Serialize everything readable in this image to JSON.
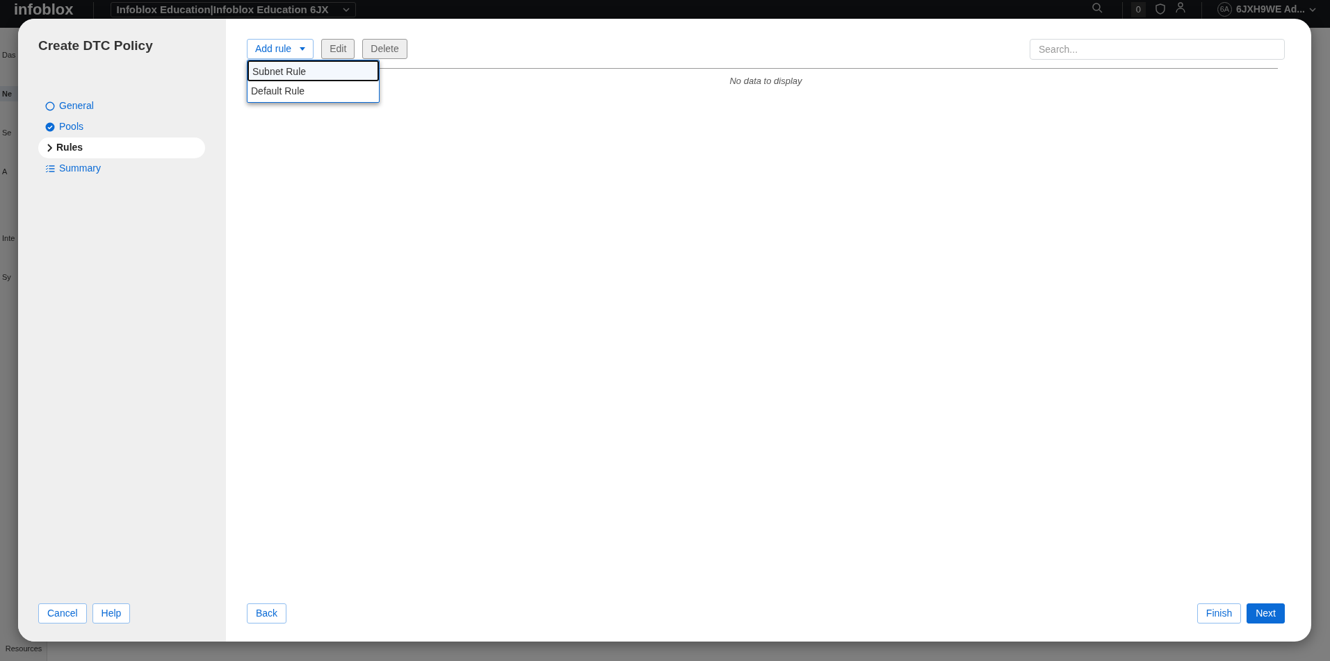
{
  "app": {
    "brand": "infoblox",
    "tenant": "Infoblox Education|Infoblox Education 6JX",
    "notifications": "0",
    "user_initials": "6A",
    "user_name": "6JXH9WE Ad...",
    "nav": [
      {
        "label": "Das",
        "selected": false
      },
      {
        "label": "Ne",
        "selected": true
      },
      {
        "label": "Se",
        "selected": false
      },
      {
        "label": "A",
        "selected": false
      },
      {
        "label": "Inte",
        "selected": false
      },
      {
        "label": "Sy",
        "selected": false
      }
    ],
    "nav_bottom": "Resources"
  },
  "modal": {
    "title": "Create DTC Policy",
    "steps": [
      {
        "label": "General",
        "kind": "pending",
        "selected": false
      },
      {
        "label": "Pools",
        "kind": "done",
        "selected": false
      },
      {
        "label": "Rules",
        "kind": "current",
        "selected": true
      },
      {
        "label": "Summary",
        "kind": "summary",
        "selected": false
      }
    ],
    "toolbar": [
      {
        "label": "Add rule",
        "kind": "dropdown",
        "disabled": false
      },
      {
        "label": "Edit",
        "kind": "plain",
        "disabled": true
      },
      {
        "label": "Delete",
        "kind": "plain",
        "disabled": true
      }
    ],
    "dropdown": [
      {
        "label": "Subnet Rule",
        "selected": true
      },
      {
        "label": "Default Rule",
        "selected": false
      }
    ],
    "search": {
      "placeholder": "Search..."
    },
    "empty_text": "No data to display",
    "footer_left": [
      {
        "label": "Cancel",
        "kind": "outline"
      },
      {
        "label": "Help",
        "kind": "outline"
      }
    ],
    "footer_back": [
      {
        "label": "Back",
        "kind": "outline"
      }
    ],
    "footer_right": [
      {
        "label": "Finish",
        "kind": "outline"
      },
      {
        "label": "Next",
        "kind": "primary"
      }
    ]
  }
}
